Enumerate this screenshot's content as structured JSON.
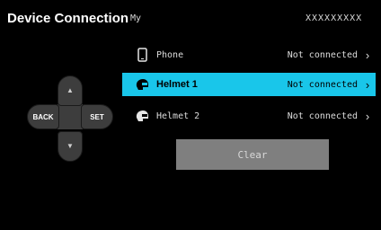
{
  "header": {
    "title": "Device Connection",
    "my_label": "My",
    "device_id": "XXXXXXXXX"
  },
  "dpad": {
    "back_label": "BACK",
    "set_label": "SET",
    "up_icon": "chevron-up-icon",
    "down_icon": "chevron-down-icon"
  },
  "devices": [
    {
      "name": "Phone",
      "status": "Not connected",
      "icon": "phone-icon",
      "selected": false
    },
    {
      "name": "Helmet 1",
      "status": "Not connected",
      "icon": "helmet-icon",
      "selected": true
    },
    {
      "name": "Helmet 2",
      "status": "Not connected",
      "icon": "helmet-icon",
      "selected": false
    }
  ],
  "actions": {
    "clear_label": "Clear"
  },
  "colors": {
    "background": "#000000",
    "selected_row": "#19c6ea",
    "button": "#7f7f7f",
    "dpad": "#3d3d3d"
  }
}
